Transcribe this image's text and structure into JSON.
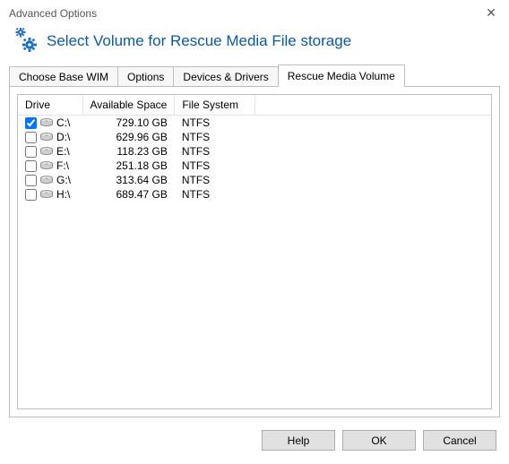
{
  "window": {
    "title": "Advanced Options"
  },
  "header": {
    "title": "Select Volume for Rescue Media File storage"
  },
  "tabs": [
    {
      "label": "Choose Base WIM",
      "active": false
    },
    {
      "label": "Options",
      "active": false
    },
    {
      "label": "Devices & Drivers",
      "active": false
    },
    {
      "label": "Rescue Media Volume",
      "active": true
    }
  ],
  "columns": {
    "drive": "Drive",
    "space": "Available Space",
    "fs": "File System"
  },
  "drives": [
    {
      "checked": true,
      "letter": "C:\\",
      "space": "729.10 GB",
      "fs": "NTFS"
    },
    {
      "checked": false,
      "letter": "D:\\",
      "space": "629.96 GB",
      "fs": "NTFS"
    },
    {
      "checked": false,
      "letter": "E:\\",
      "space": "118.23 GB",
      "fs": "NTFS"
    },
    {
      "checked": false,
      "letter": "F:\\",
      "space": "251.18 GB",
      "fs": "NTFS"
    },
    {
      "checked": false,
      "letter": "G:\\",
      "space": "313.64 GB",
      "fs": "NTFS"
    },
    {
      "checked": false,
      "letter": "H:\\",
      "space": "689.47 GB",
      "fs": "NTFS"
    }
  ],
  "buttons": {
    "help": "Help",
    "ok": "OK",
    "cancel": "Cancel"
  }
}
